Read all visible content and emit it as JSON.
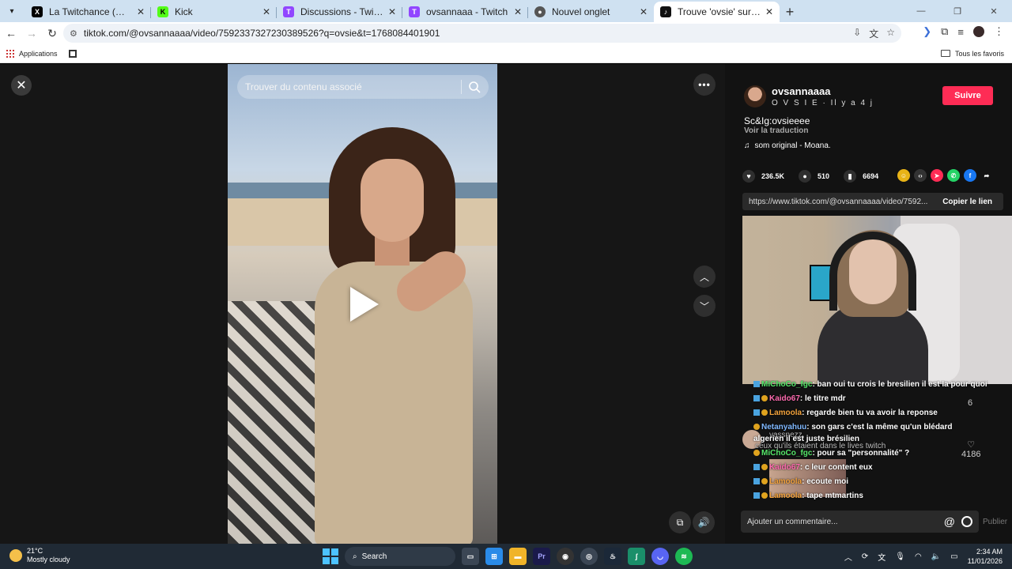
{
  "browser": {
    "tabs": [
      {
        "title": "La Twitchance (@LaTwitchance) /",
        "favicon": "x-icon",
        "color": "#000000",
        "active": false
      },
      {
        "title": "Kick",
        "favicon": "kick-icon",
        "color": "#53fc18",
        "active": false
      },
      {
        "title": "Discussions - Twitch",
        "favicon": "twitch-icon",
        "color": "#9146ff",
        "active": false
      },
      {
        "title": "ovsannaaa - Twitch",
        "favicon": "twitch-icon",
        "color": "#9146ff",
        "active": false
      },
      {
        "title": "Nouvel onglet",
        "favicon": "chrome-icon",
        "color": "#555555",
        "active": false
      },
      {
        "title": "Trouve 'ovsie' sur TikTok | Reche",
        "favicon": "tiktok-icon",
        "color": "#111111",
        "active": true
      }
    ],
    "url": "tiktok.com/@ovsannaaaa/video/7592337327230389526?q=ovsie&t=1768084401901",
    "bookmarks": {
      "apps_label": "Applications",
      "all_favorites_label": "Tous les favoris"
    }
  },
  "video": {
    "search_placeholder": "Trouver du contenu associé"
  },
  "post": {
    "username": "ovsannaaaa",
    "display_name": "O V S I E · Il y a 4 j",
    "follow_label": "Suivre",
    "description": "Sc&Ig:ovsieeee",
    "translate_label": "Voir la traduction",
    "music": "som original - Moana.",
    "likes": "236.5K",
    "comments": "510",
    "saves": "6694",
    "share_link": "https://www.tiktok.com/@ovsannaaaa/video/7592...",
    "copy_label": "Copier le lien",
    "comment_placeholder": "Ajouter un commentaire...",
    "publish_label": "Publier",
    "side_count_a": "6",
    "side_count_b": "4186"
  },
  "stream_chat": [
    {
      "user": "MiChoCo_fgc",
      "msg": ": ban oui tu crois le bresilien il est la pour quoi",
      "color": "green"
    },
    {
      "user": "Kaido67",
      "msg": ": le titre mdr",
      "color": "pink"
    },
    {
      "user": "Lamoola",
      "msg": ": regarde bien tu va avoir la reponse",
      "color": "orange"
    },
    {
      "user": "Netanyahuu",
      "msg": ": son gars c'est la même qu'un blédard",
      "color": "blue"
    },
    {
      "user": "",
      "msg": "algerien il est juste brésilien",
      "color": "white"
    },
    {
      "user": "MiChoCo_fgc",
      "msg": ": pour sa \"personnalité\" ?",
      "color": "green"
    },
    {
      "user": "Kaido67",
      "msg": ": c leur content eux",
      "color": "pink"
    },
    {
      "user": "Lamoola",
      "msg": ": ecoute moi",
      "color": "orange"
    },
    {
      "user": "Lamoola",
      "msg": ": tape mtmartins",
      "color": "orange"
    }
  ],
  "ghost_text": {
    "line_a": "vassnezz",
    "line_b": "ceux qu'ils étaient dans le lives twitch"
  },
  "taskbar": {
    "temp": "21°C",
    "weather": "Mostly cloudy",
    "search_label": "Search",
    "time": "2:34 AM",
    "date": "11/01/2026"
  }
}
